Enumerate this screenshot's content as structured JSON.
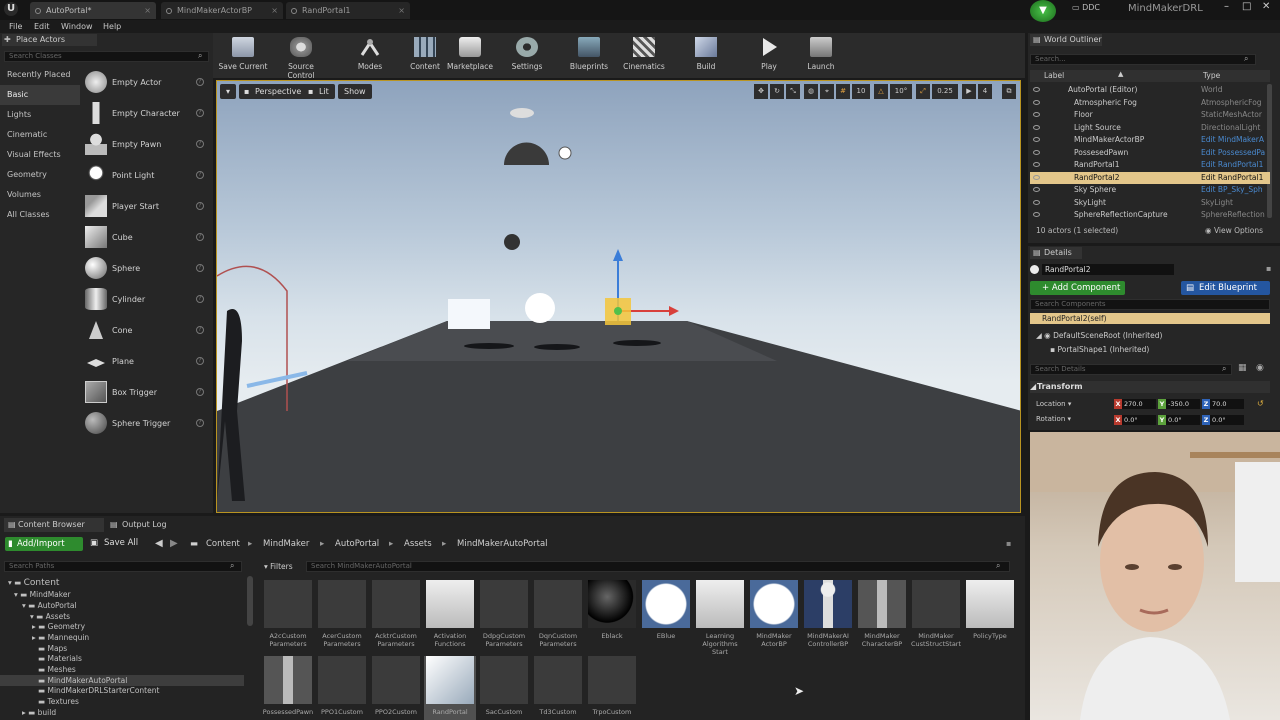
{
  "titlebar": {
    "tabs": [
      "AutoPortal*",
      "MindMakerActorBP",
      "RandPortal1"
    ],
    "source": "DDC",
    "project": "MindMakerDRL"
  },
  "menu": [
    "File",
    "Edit",
    "Window",
    "Help"
  ],
  "place_actors": {
    "title": "Place Actors",
    "search_placeholder": "Search Classes",
    "categories": [
      "Recently Placed",
      "Basic",
      "Lights",
      "Cinematic",
      "Visual Effects",
      "Geometry",
      "Volumes",
      "All Classes"
    ],
    "selected_category": "Basic",
    "actors": [
      "Empty Actor",
      "Empty Character",
      "Empty Pawn",
      "Point Light",
      "Player Start",
      "Cube",
      "Sphere",
      "Cylinder",
      "Cone",
      "Plane",
      "Box Trigger",
      "Sphere Trigger"
    ]
  },
  "toolbar": [
    "Save Current",
    "Source Control",
    "Modes",
    "Content",
    "Marketplace",
    "Settings",
    "Blueprints",
    "Cinematics",
    "Build",
    "Play",
    "Launch"
  ],
  "viewport": {
    "perspective": "Perspective",
    "lit": "Lit",
    "show": "Show",
    "grid": "10",
    "rot": "10°",
    "scale": "0.25",
    "cam": "4"
  },
  "content_browser": {
    "tabs": [
      "Content Browser",
      "Output Log"
    ],
    "add_import": "Add/Import",
    "save_all": "Save All",
    "breadcrumb": [
      "Content",
      "MindMaker",
      "AutoPortal",
      "Assets",
      "MindMakerAutoPortal"
    ],
    "search_paths_placeholder": "Search Paths",
    "filters": "Filters",
    "search_assets_placeholder": "Search MindMakerAutoPortal",
    "tree": [
      "Content",
      "MindMaker",
      "AutoPortal",
      "Assets",
      "Geometry",
      "Mannequin",
      "Maps",
      "Materials",
      "Meshes",
      "MindMakerAutoPortal",
      "MindMakerDRLStarterContent",
      "Textures",
      "build"
    ],
    "tree_selected": "MindMakerAutoPortal",
    "assets": [
      "A2cCustom Parameters",
      "AcerCustom Parameters",
      "AcktrCustom Parameters",
      "Activation Functions",
      "DdpgCustom Parameters",
      "DqnCustom Parameters",
      "Eblack",
      "EBlue",
      "Learning Algorithms Start",
      "MindMaker ActorBP",
      "MindMakerAI ControllerBP",
      "MindMaker CharacterBP",
      "MindMaker CustStructStart",
      "PolicyType",
      "PossessedPawn",
      "PPO1Custom",
      "PPO2Custom",
      "RandPortal",
      "SacCustom",
      "Td3Custom",
      "TrpoCustom"
    ]
  },
  "outliner": {
    "title": "World Outliner",
    "search_placeholder": "Search...",
    "col_label": "Label",
    "col_type": "Type",
    "rows": [
      {
        "label": "AutoPortal (Editor)",
        "type": "World"
      },
      {
        "label": "Atmospheric Fog",
        "type": "AtmosphericFog"
      },
      {
        "label": "Floor",
        "type": "StaticMeshActor"
      },
      {
        "label": "Light Source",
        "type": "DirectionalLight"
      },
      {
        "label": "MindMakerActorBP",
        "type": "Edit MindMakerA"
      },
      {
        "label": "PossesedPawn",
        "type": "Edit PossessedPa"
      },
      {
        "label": "RandPortal1",
        "type": "Edit RandPortal1"
      },
      {
        "label": "RandPortal2",
        "type": "Edit RandPortal1"
      },
      {
        "label": "Sky Sphere",
        "type": "Edit BP_Sky_Sph"
      },
      {
        "label": "SkyLight",
        "type": "SkyLight"
      },
      {
        "label": "SphereReflectionCapture",
        "type": "SphereReflection"
      }
    ],
    "selected_row": "RandPortal2",
    "count": "10 actors (1 selected)",
    "view_options": "View Options"
  },
  "details": {
    "title": "Details",
    "name": "RandPortal2",
    "add_component": "+ Add Component",
    "edit_blueprint": "Edit Blueprint",
    "search_components_placeholder": "Search Components",
    "components": [
      "RandPortal2(self)",
      "DefaultSceneRoot (Inherited)",
      "PortalShape1 (Inherited)"
    ],
    "search_details_placeholder": "Search Details",
    "section": "Transform",
    "location_label": "Location",
    "location": [
      "270.0",
      "-350.0",
      "70.0"
    ],
    "rotation_label": "Rotation",
    "rotation": [
      "0.0°",
      "0.0°",
      "0.0°"
    ]
  },
  "colors": {
    "accent_green": "#2e8b2e",
    "accent_blue": "#2456a0",
    "selection": "#e3c68a",
    "viewport_border": "#b99421"
  }
}
